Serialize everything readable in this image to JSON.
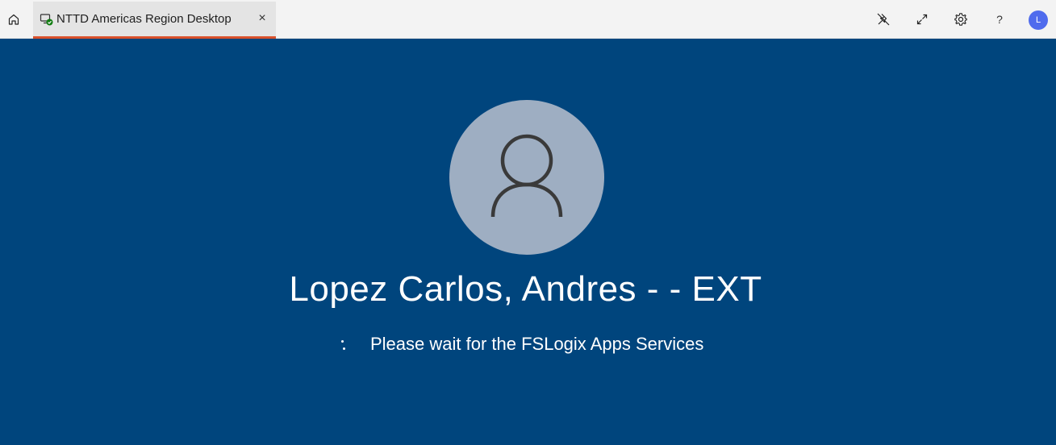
{
  "tab": {
    "title": "NTTD Americas Region Desktop",
    "close_glyph": "×"
  },
  "toolbar": {
    "help_glyph": "?",
    "account_initial": "L"
  },
  "icons": {
    "home": "home-icon",
    "desktop_connected": "monitor-check-icon",
    "unpin": "unpin-icon",
    "expand": "expand-icon",
    "settings": "gear-icon"
  },
  "colors": {
    "desktop_background": "#00457d",
    "tab_accent": "#d9512c",
    "avatar_background": "#9eaec2",
    "account_avatar": "#4f6bed",
    "connected_badge": "#107c10"
  },
  "login": {
    "user_name": "Lopez Carlos, Andres - - EXT",
    "status_message": "Please wait for the FSLogix Apps Services"
  }
}
